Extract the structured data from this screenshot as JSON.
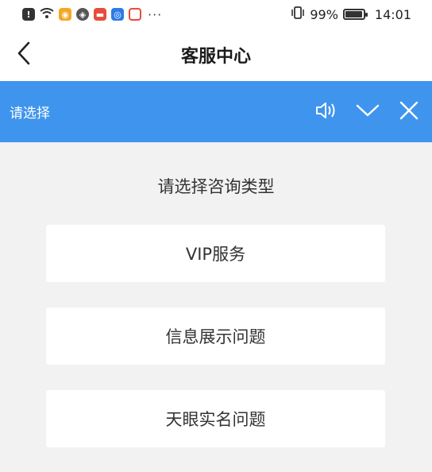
{
  "status_bar": {
    "battery_percent": "99%",
    "time": "14:01",
    "more_indicator": "···",
    "icons": [
      "alert-icon",
      "wifi-icon",
      "weibo-icon",
      "app-icon",
      "app-red-icon",
      "app-blue-icon",
      "app-red-outline-icon",
      "vibrate-icon",
      "battery-icon"
    ]
  },
  "header": {
    "title": "客服中心",
    "back_icon": "chevron-left-icon"
  },
  "prompt_bar": {
    "label": "请选择",
    "actions": [
      "speaker-icon",
      "chevron-down-icon",
      "close-icon"
    ],
    "color": "#3f95ee"
  },
  "main": {
    "section_title": "请选择咨询类型",
    "options": [
      {
        "label": "VIP服务"
      },
      {
        "label": "信息展示问题"
      },
      {
        "label": "天眼实名问题"
      }
    ]
  }
}
